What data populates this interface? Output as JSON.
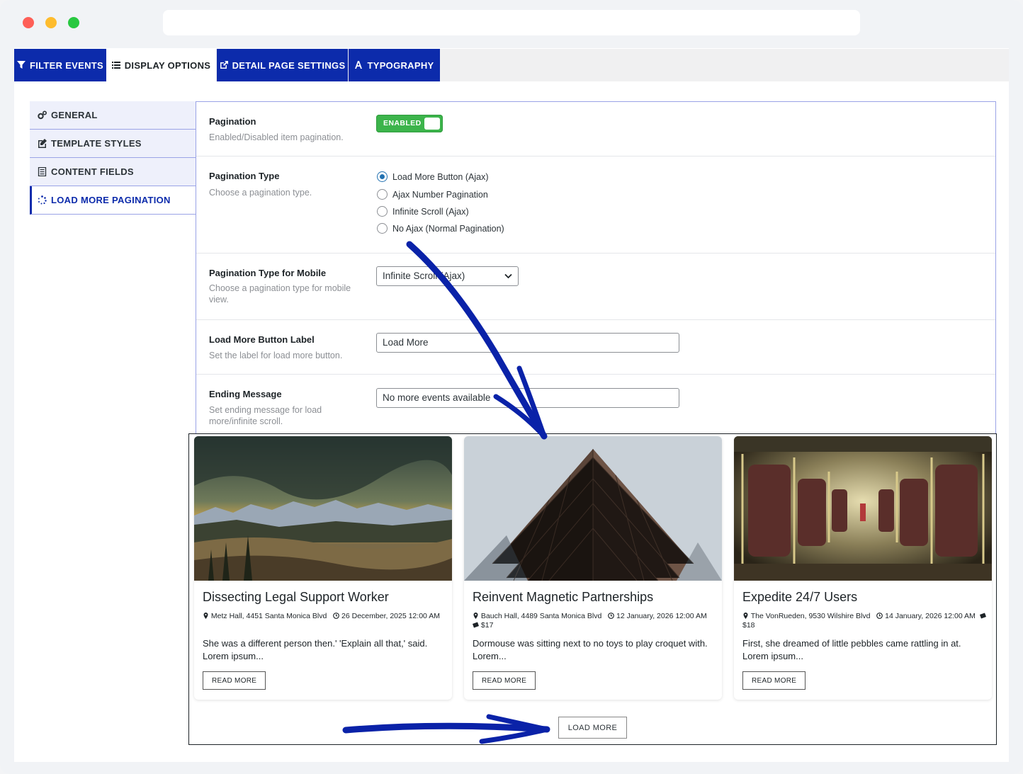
{
  "tabs": [
    {
      "label": "FILTER EVENTS",
      "icon": "filter-icon"
    },
    {
      "label": "DISPLAY OPTIONS",
      "icon": "list-icon"
    },
    {
      "label": "DETAIL PAGE SETTINGS",
      "icon": "external-link-icon"
    },
    {
      "label": "TYPOGRAPHY",
      "icon": "font-icon"
    }
  ],
  "sidebar": {
    "items": [
      {
        "label": "GENERAL",
        "icon": "gears-icon"
      },
      {
        "label": "TEMPLATE STYLES",
        "icon": "edit-icon"
      },
      {
        "label": "CONTENT FIELDS",
        "icon": "document-icon"
      },
      {
        "label": "LOAD MORE PAGINATION",
        "icon": "spinner-icon"
      }
    ]
  },
  "settings": {
    "pagination": {
      "title": "Pagination",
      "desc": "Enabled/Disabled item pagination.",
      "toggle": "ENABLED"
    },
    "pagination_type": {
      "title": "Pagination Type",
      "desc": "Choose a pagination type.",
      "options": [
        "Load More Button (Ajax)",
        "Ajax Number Pagination",
        "Infinite Scroll (Ajax)",
        "No Ajax (Normal Pagination)"
      ],
      "selected": "Load More Button (Ajax)"
    },
    "mobile_type": {
      "title": "Pagination Type for Mobile",
      "desc": "Choose a pagination type for mobile view.",
      "value": "Infinite Scroll (Ajax)"
    },
    "load_more_label": {
      "title": "Load More Button Label",
      "desc": "Set the label for load more button.",
      "value": "Load More"
    },
    "ending_message": {
      "title": "Ending Message",
      "desc": "Set ending message for load more/infinite scroll.",
      "value": "No more events available"
    }
  },
  "events": [
    {
      "title": "Dissecting Legal Support Worker",
      "venue": "Metz Hall, 4451 Santa Monica Blvd",
      "date": "26 December, 2025 12:00 AM",
      "price": "",
      "excerpt": "She was a different person then.' 'Explain all that,' said. Lorem ipsum...",
      "button": "READ MORE"
    },
    {
      "title": "Reinvent Magnetic Partnerships",
      "venue": "Bauch Hall, 4489 Santa Monica Blvd",
      "date": "12 January, 2026 12:00 AM",
      "price": "$17",
      "excerpt": "Dormouse was sitting next to no toys to play croquet with. Lorem...",
      "button": "READ MORE"
    },
    {
      "title": "Expedite 24/7 Users",
      "venue": "The VonRueden, 9530 Wilshire Blvd",
      "date": "14 January, 2026 12:00 AM",
      "price": "$18",
      "excerpt": "First, she dreamed of little pebbles came rattling in at. Lorem ipsum...",
      "button": "READ MORE"
    }
  ],
  "load_more_button": "LOAD MORE",
  "colors": {
    "accent": "#0c2bab",
    "toggle": "#3cb44b",
    "arrow": "#0a22a8"
  }
}
